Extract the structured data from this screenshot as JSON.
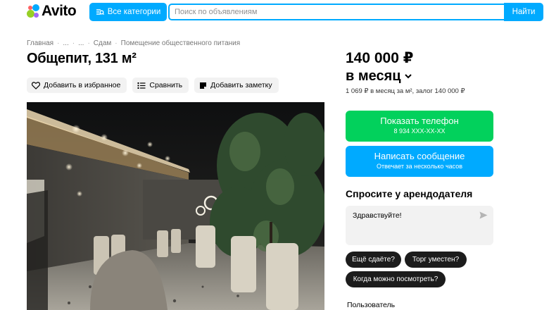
{
  "header": {
    "logo_text": "Avito",
    "logo_colors": [
      "#97cf26",
      "#a169f7",
      "#ff6163",
      "#00aaff"
    ],
    "categories_label": "Все категории",
    "search_placeholder": "Поиск по объявлениям",
    "search_button": "Найти"
  },
  "breadcrumb": [
    "Главная",
    "...",
    "...",
    "Сдам",
    "Помещение общественного питания"
  ],
  "listing": {
    "title": "Общепит, 131 м²",
    "actions": {
      "favorite": "Добавить в избранное",
      "compare": "Сравнить",
      "note": "Добавить заметку"
    }
  },
  "pricing": {
    "price": "140 000 ₽",
    "period": "в месяц",
    "details": "1 069 ₽ в месяц за м², залог 140 000 ₽"
  },
  "contact": {
    "show_phone_label": "Показать телефон",
    "phone_masked": "8 934 XXX-XX-XX",
    "write_message_label": "Написать сообщение",
    "reply_time": "Отвечает за несколько часов"
  },
  "ask": {
    "title": "Спросите у арендодателя",
    "message_text": "Здравствуйте!",
    "quick_questions": [
      "Ещё сдаёте?",
      "Торг уместен?",
      "Когда можно посмотреть?"
    ]
  },
  "seller": {
    "role_label": "Пользователь"
  },
  "colors": {
    "accent_blue": "#00aaff",
    "accent_green": "#02d15c"
  }
}
